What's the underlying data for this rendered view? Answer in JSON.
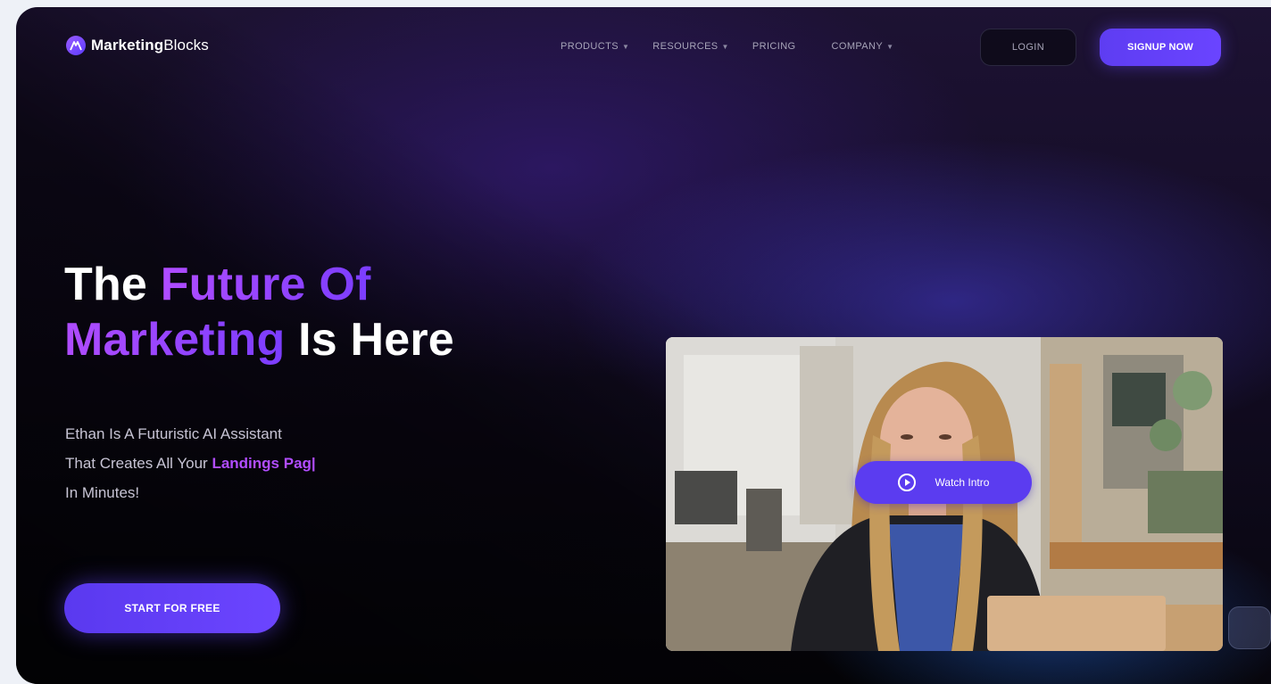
{
  "brand": {
    "name_bold": "Marketing",
    "name_rest": "Blocks",
    "logo_icon": "marketingblocks-logo-icon"
  },
  "nav": {
    "items": [
      {
        "label": "PRODUCTS",
        "dropdown": true
      },
      {
        "label": "RESOURCES",
        "dropdown": true
      },
      {
        "label": "PRICING",
        "dropdown": false
      },
      {
        "label": "COMPANY",
        "dropdown": true
      }
    ],
    "login_label": "LOGIN",
    "signup_label": "SIGNUP NOW"
  },
  "hero": {
    "title_line1_plain": "The",
    "title_line1_accent": "Future Of",
    "title_line2_accent": "Marketing",
    "title_line2_plain": "Is Here",
    "subtitle_line1": "Ethan Is A Futuristic AI Assistant",
    "subtitle_line2_plain": "That Creates All Your",
    "subtitle_line2_accent": "Landings Pag|",
    "subtitle_line3": "In Minutes!",
    "cta_label": "START FOR FREE"
  },
  "video": {
    "watch_label": "Watch Intro",
    "play_icon": "play-circle-icon"
  },
  "colors": {
    "accent_purple": "#6a44ff",
    "accent_gradient_start": "#b04cff",
    "background_dark": "#07060d"
  }
}
